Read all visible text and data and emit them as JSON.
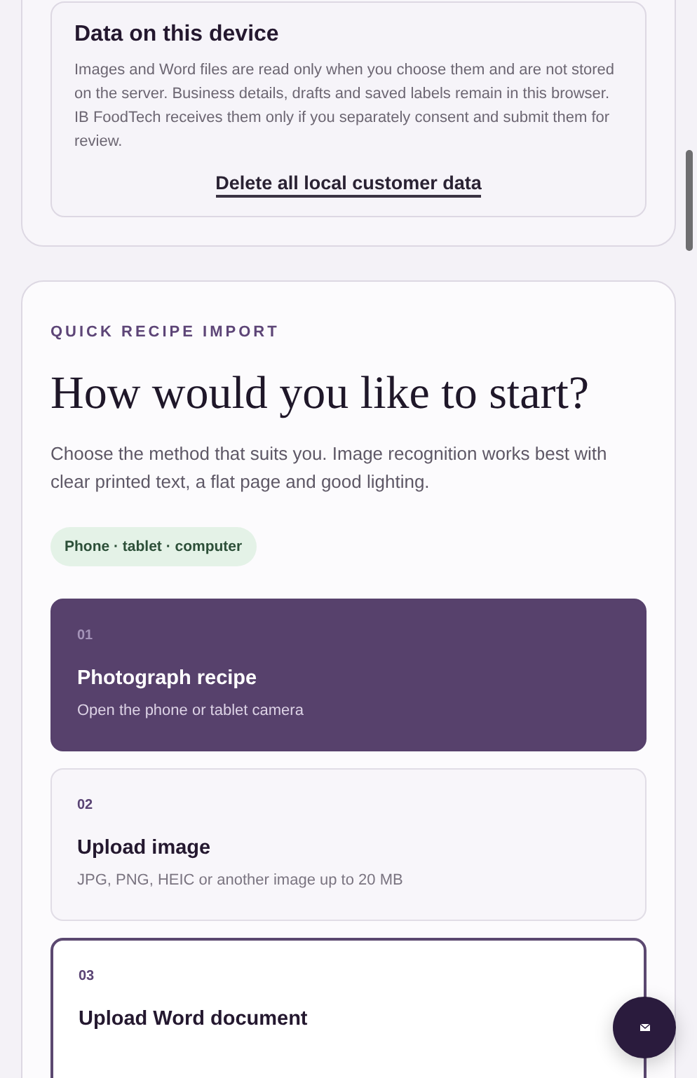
{
  "privacy_card": {
    "title": "Data on this device",
    "text": "Images and Word files are read only when you choose them and are not stored on the server. Business details, drafts and saved labels remain in this browser. IB FoodTech receives them only if you separately consent and submit them for review.",
    "delete_link": "Delete all local customer data"
  },
  "import_card": {
    "eyebrow": "QUICK RECIPE IMPORT",
    "heading": "How would you like to start?",
    "intro": "Choose the method that suits you. Image recognition works best with clear printed text, a flat page and good lighting.",
    "badge": "Phone · tablet · computer",
    "options": [
      {
        "number": "01",
        "title": "Photograph recipe",
        "description": "Open the phone or tablet camera",
        "selected": true,
        "focused": false
      },
      {
        "number": "02",
        "title": "Upload image",
        "description": "JPG, PNG, HEIC or another image up to 20 MB",
        "selected": false,
        "focused": false
      },
      {
        "number": "03",
        "title": "Upload Word document",
        "selected": false,
        "focused": true
      }
    ]
  }
}
